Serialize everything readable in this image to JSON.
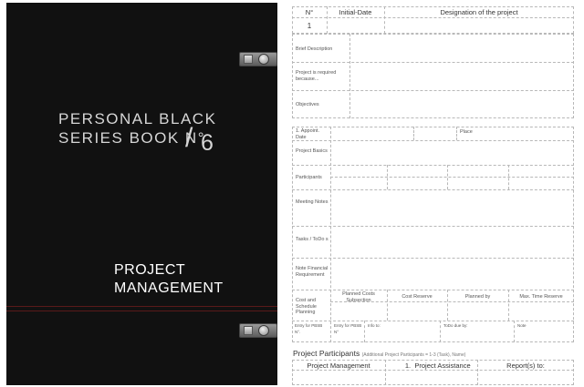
{
  "cover": {
    "title_line1": "PERSONAL BLACK",
    "title_line2": "SERIES BOOK N°",
    "slash": "/",
    "number": "6",
    "subtitle_line1": "PROJECT",
    "subtitle_line2": "MANAGEMENT"
  },
  "form": {
    "header": {
      "no": "N°",
      "initial_date": "Initial-Date",
      "designation": "Designation of the project",
      "number_value": "1"
    },
    "description_rows": [
      "Brief Description",
      "Project is required because...",
      "Objectives"
    ],
    "meeting": {
      "appoint": "1. Appoint. Date",
      "place": "Place",
      "rows": [
        "Project Basics",
        "Participants",
        "Meeting Notes",
        "Tasks / ToDo s",
        "Note Financial Requirement"
      ],
      "cost_label": "Cost and Schedule Planning",
      "cost_cols": [
        "Planned Costs Subsection",
        "Cost Reserve",
        "Planned by",
        "Max. Time Reserve"
      ],
      "footer": [
        "Entry for PBSB N°.",
        "Entry for PBSB N°",
        "Info to:",
        "ToDo due by:",
        "Note"
      ]
    },
    "participants": {
      "title": "Project Participants",
      "subtitle": "(Additional Project Participants = 1-3 (Task), Name)",
      "cols": [
        "Project Management",
        "1.",
        "Project Assistance",
        "Report(s) to:"
      ]
    }
  }
}
